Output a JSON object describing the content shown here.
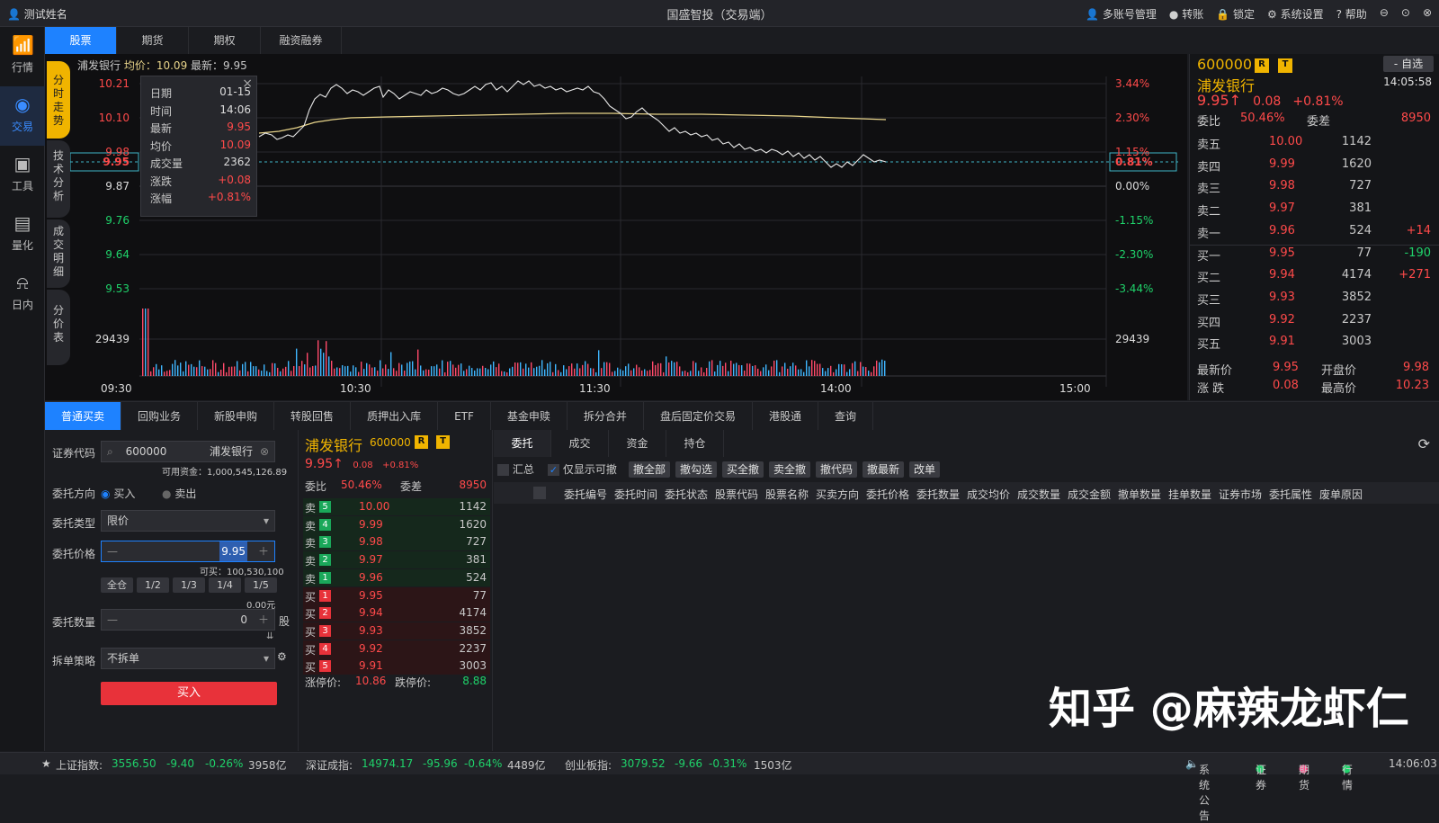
{
  "titlebar": {
    "user": "测试姓名",
    "title": "国盛智投（交易端）",
    "menu": [
      "多账号管理",
      "转账",
      "锁定",
      "系统设置",
      "帮助"
    ]
  },
  "leftnav": [
    {
      "label": "行情",
      "icon": "chart-bars-icon"
    },
    {
      "label": "交易",
      "icon": "trade-icon"
    },
    {
      "label": "工具",
      "icon": "toolbox-icon"
    },
    {
      "label": "量化",
      "icon": "quant-icon"
    },
    {
      "label": "日内",
      "icon": "intraday-icon"
    }
  ],
  "toptabs": [
    "股票",
    "期货",
    "期权",
    "融资融券"
  ],
  "sidetabs": [
    "分时走势",
    "技术分析",
    "成交明细",
    "分价表"
  ],
  "chart": {
    "stock_name": "浦发银行",
    "avg_label": "均价：10.09",
    "last_label": "最新：9.95",
    "left_labels": [
      "10.21",
      "10.10",
      "9.98",
      "9.87",
      "9.76",
      "9.64",
      "9.53",
      "29439"
    ],
    "right_labels": [
      "3.44%",
      "2.30%",
      "1.15%",
      "0.00%",
      "-1.15%",
      "-2.30%",
      "-3.44%",
      "29439"
    ],
    "cursor_price": "9.95",
    "cursor_pct": "0.81%",
    "time_labels": [
      "09:30",
      "10:30",
      "11:30",
      "14:00",
      "15:00"
    ]
  },
  "tooltip": {
    "rows": [
      {
        "k": "日期",
        "v": "01-15"
      },
      {
        "k": "时间",
        "v": "14:06"
      },
      {
        "k": "最新",
        "v": "9.95"
      },
      {
        "k": "均价",
        "v": "10.09"
      },
      {
        "k": "成交量",
        "v": "2362"
      },
      {
        "k": "涨跌",
        "v": "+0.08"
      },
      {
        "k": "涨幅",
        "v": "+0.81%"
      }
    ]
  },
  "quote": {
    "code": "600000",
    "name": "浦发银行",
    "price": "9.95",
    "change": "0.08",
    "pct": "+0.81%",
    "time": "14:05:58",
    "fav": "- 自选",
    "ratio_label": "委比",
    "ratio": "50.46%",
    "diff_label": "委差",
    "diff": "8950",
    "asks": [
      {
        "l": "卖五",
        "p": "10.00",
        "v": "1142",
        "c": ""
      },
      {
        "l": "卖四",
        "p": "9.99",
        "v": "1620",
        "c": ""
      },
      {
        "l": "卖三",
        "p": "9.98",
        "v": "727",
        "c": ""
      },
      {
        "l": "卖二",
        "p": "9.97",
        "v": "381",
        "c": ""
      },
      {
        "l": "卖一",
        "p": "9.96",
        "v": "524",
        "c": "+14"
      }
    ],
    "bids": [
      {
        "l": "买一",
        "p": "9.95",
        "v": "77",
        "c": "-190"
      },
      {
        "l": "买二",
        "p": "9.94",
        "v": "4174",
        "c": "+271"
      },
      {
        "l": "买三",
        "p": "9.93",
        "v": "3852",
        "c": ""
      },
      {
        "l": "买四",
        "p": "9.92",
        "v": "2237",
        "c": ""
      },
      {
        "l": "买五",
        "p": "9.91",
        "v": "3003",
        "c": ""
      }
    ],
    "last_label": "最新价",
    "last": "9.95",
    "open_label": "开盘价",
    "open": "9.98",
    "chg_label": "涨  跌",
    "chg": "0.08",
    "high_label": "最高价",
    "high": "10.23"
  },
  "bottabs": [
    "普通买卖",
    "回购业务",
    "新股申购",
    "转股回售",
    "质押出入库",
    "ETF",
    "基金申赎",
    "拆分合并",
    "盘后固定价交易",
    "港股通",
    "查询"
  ],
  "form": {
    "code_label": "证券代码",
    "code": "600000",
    "code_name": "浦发银行",
    "funds": "可用资金：1,000,545,126.89",
    "dir_label": "委托方向",
    "buy": "买入",
    "sell": "卖出",
    "type_label": "委托类型",
    "type": "限价",
    "price_label": "委托价格",
    "price": "9.95",
    "can_buy": "可买：100,530,100",
    "portions": [
      "全仓",
      "1/2",
      "1/3",
      "1/4",
      "1/5"
    ],
    "amount": "0.00元",
    "qty_label": "委托数量",
    "qty": "0",
    "qty_unit": "股",
    "split_label": "拆单策略",
    "split": "不拆单",
    "submit": "买入"
  },
  "midbook": {
    "name": "浦发银行",
    "code": "600000",
    "price": "9.95",
    "change": "0.08",
    "pct": "+0.81%",
    "ratio_label": "委比",
    "ratio": "50.46%",
    "diff_label": "委差",
    "diff": "8950",
    "asks": [
      {
        "l": "卖",
        "n": "5",
        "p": "10.00",
        "v": "1142"
      },
      {
        "l": "卖",
        "n": "4",
        "p": "9.99",
        "v": "1620"
      },
      {
        "l": "卖",
        "n": "3",
        "p": "9.98",
        "v": "727"
      },
      {
        "l": "卖",
        "n": "2",
        "p": "9.97",
        "v": "381"
      },
      {
        "l": "卖",
        "n": "1",
        "p": "9.96",
        "v": "524"
      }
    ],
    "bids": [
      {
        "l": "买",
        "n": "1",
        "p": "9.95",
        "v": "77"
      },
      {
        "l": "买",
        "n": "2",
        "p": "9.94",
        "v": "4174"
      },
      {
        "l": "买",
        "n": "3",
        "p": "9.93",
        "v": "3852"
      },
      {
        "l": "买",
        "n": "4",
        "p": "9.92",
        "v": "2237"
      },
      {
        "l": "买",
        "n": "5",
        "p": "9.91",
        "v": "3003"
      }
    ],
    "limit_up_label": "涨停价:",
    "limit_up": "10.86",
    "limit_down_label": "跌停价:",
    "limit_down": "8.88"
  },
  "orders": {
    "tabs": [
      "委托",
      "成交",
      "资金",
      "持仓"
    ],
    "summary": "汇总",
    "only_cancelable": "仅显示可撤",
    "buttons": [
      "撤全部",
      "撤勾选",
      "买全撤",
      "卖全撤",
      "撤代码",
      "撤最新",
      "改单"
    ],
    "columns": [
      "委托编号",
      "委托时间",
      "委托状态",
      "股票代码",
      "股票名称",
      "买卖方向",
      "委托价格",
      "委托数量",
      "成交均价",
      "成交数量",
      "成交金额",
      "撤单数量",
      "挂单数量",
      "证券市场",
      "委托属性",
      "废单原因"
    ]
  },
  "statusbar": {
    "sh_label": "上证指数:",
    "sh": "3556.50",
    "sh_chg": "-9.40",
    "sh_pct": "-0.26%",
    "sh_amt": "3958亿",
    "sz_label": "深证成指:",
    "sz": "14974.17",
    "sz_chg": "-95.96",
    "sz_pct": "-0.64%",
    "sz_amt": "4489亿",
    "cy_label": "创业板指:",
    "cy": "3079.52",
    "cy_chg": "-9.66",
    "cy_pct": "-0.31%",
    "cy_amt": "1503亿",
    "notice": "系统公告",
    "s1": "证券",
    "s2": "期货",
    "s3": "行情",
    "time": "14:06:03"
  },
  "watermark": "知乎 @麻辣龙虾仁",
  "colors": {
    "up": "#ff4a4a",
    "down": "#1fd26a",
    "accent": "#1e82ff",
    "avg": "#e8d48a",
    "price": "#ffffff"
  }
}
